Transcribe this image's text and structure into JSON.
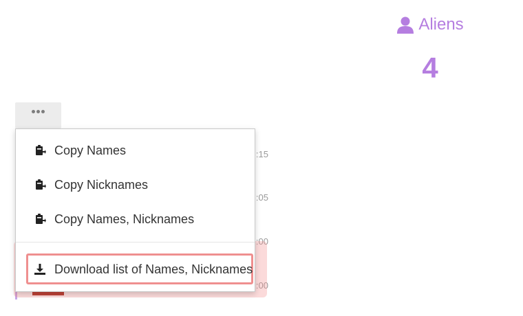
{
  "stats": {
    "label": "Aliens",
    "value": "4",
    "icon": "user-icon",
    "accent_color": "#b57ee0"
  },
  "background_list": {
    "rows": [
      {
        "time": ":15",
        "bar_color": "#c9a6ea"
      },
      {
        "time": ":05",
        "bar_color": "#c9a6ea"
      },
      {
        "time": ":00",
        "bar_color": "#c9a6ea"
      },
      {
        "time": ":00",
        "bar_color": "#c9a6ea"
      }
    ]
  },
  "more_button": {
    "icon": "ellipsis-icon"
  },
  "menu": {
    "items": [
      {
        "label": "Copy Names",
        "icon": "clipboard-copy-icon"
      },
      {
        "label": "Copy Nicknames",
        "icon": "clipboard-copy-icon"
      },
      {
        "label": "Copy Names, Nicknames",
        "icon": "clipboard-copy-icon"
      },
      {
        "label": "Download list of Names, Nicknames",
        "icon": "download-icon"
      }
    ]
  },
  "highlight_color": "#ef8f8f"
}
